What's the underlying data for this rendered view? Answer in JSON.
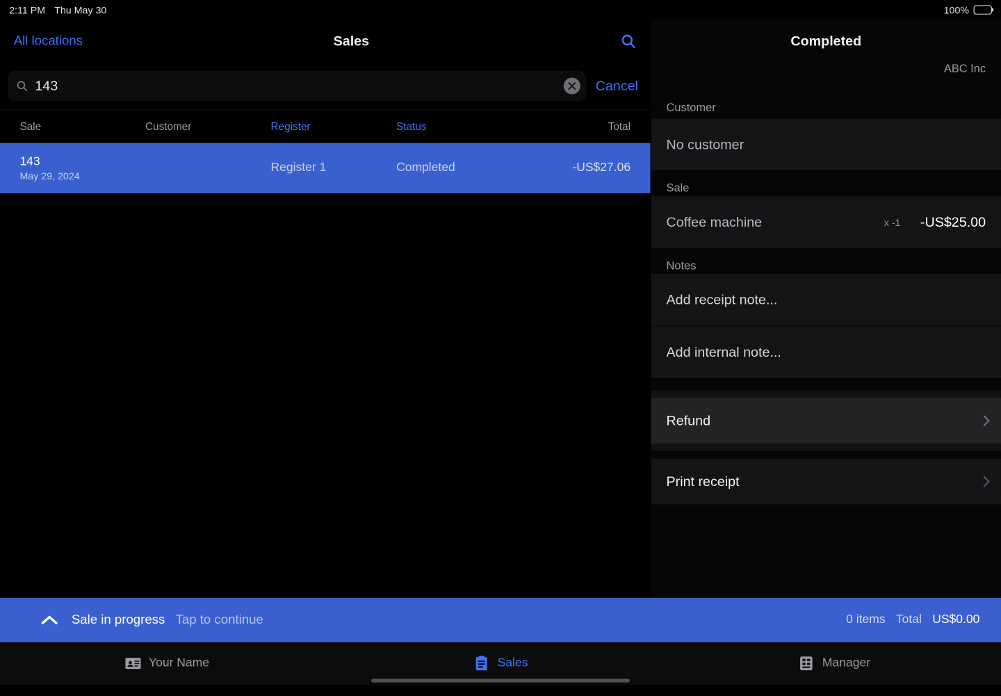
{
  "status_bar": {
    "time": "2:11 PM",
    "date": "Thu May 30",
    "battery_percent": "100%"
  },
  "left": {
    "back_link": "All locations",
    "title": "Sales",
    "search_value": "143",
    "cancel_label": "Cancel",
    "columns": {
      "c0": "Sale",
      "c1": "Customer",
      "c2": "Register",
      "c3": "Status",
      "c4": "Total"
    },
    "row": {
      "id": "143",
      "date": "May 29, 2024",
      "register": "Register 1",
      "status": "Completed",
      "total": "-US$27.06"
    }
  },
  "right": {
    "title": "Completed",
    "company": "ABC Inc",
    "section_customer": "Customer",
    "no_customer": "No customer",
    "section_sale": "Sale",
    "item": {
      "name": "Coffee machine",
      "qty": "x -1",
      "amount": "-US$25.00"
    },
    "section_notes": "Notes",
    "add_receipt_note": "Add receipt note...",
    "add_internal_note": "Add internal note...",
    "refund": "Refund",
    "print_receipt": "Print receipt"
  },
  "banner": {
    "sip": "Sale in progress",
    "tap": "Tap to continue",
    "items": "0 items",
    "total_label": "Total",
    "amount": "US$0.00"
  },
  "tabs": {
    "profile": "Your Name",
    "sales": "Sales",
    "manager": "Manager"
  }
}
